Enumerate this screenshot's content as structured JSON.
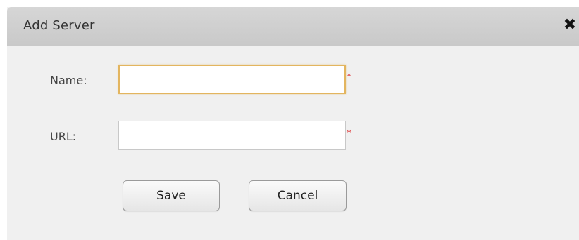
{
  "dialog": {
    "title": "Add Server",
    "close_icon": "close-icon"
  },
  "form": {
    "name": {
      "label": "Name:",
      "value": "",
      "required_marker": "*"
    },
    "url": {
      "label": "URL:",
      "value": "",
      "required_marker": "*"
    }
  },
  "buttons": {
    "save": "Save",
    "cancel": "Cancel"
  },
  "colors": {
    "focus_border": "#e3b55f",
    "required": "#dd3333",
    "titlebar": "#cccccc",
    "body": "#f0f0f0"
  }
}
